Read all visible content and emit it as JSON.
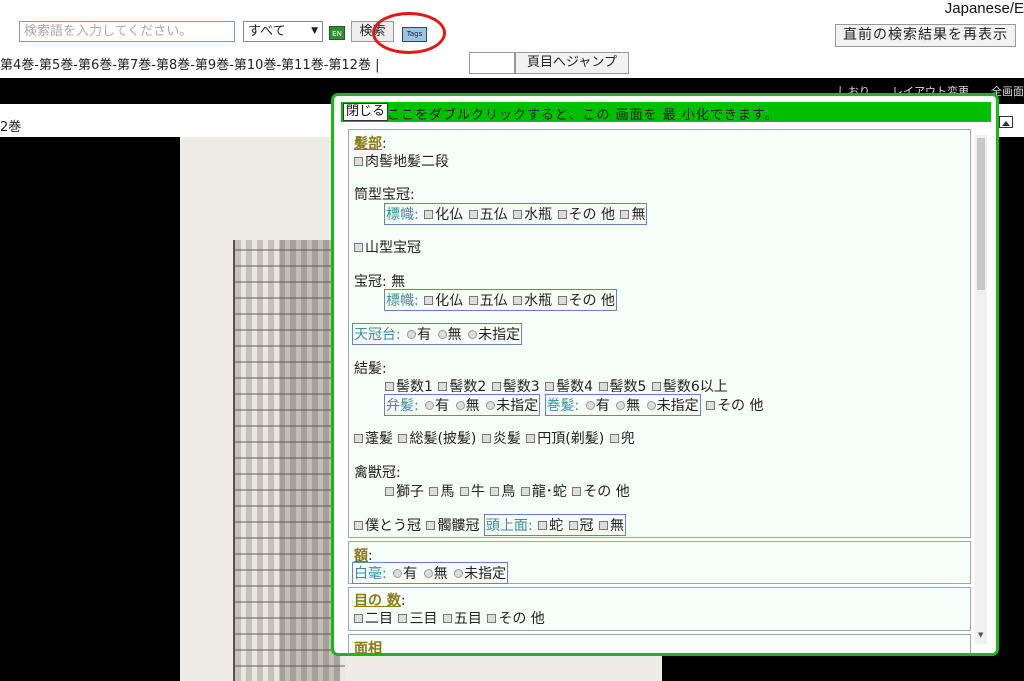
{
  "header": {
    "language": "Japanese/E",
    "search_placeholder": "検索語を入力してください。",
    "scope_selected": "すべて",
    "en_badge": "EN",
    "search_label": "検索",
    "tags_label": "Tags",
    "redisplay_label": "直前の検索結果を再表示"
  },
  "volume_nav": {
    "items": [
      "第4巻",
      "第5巻",
      "第6巻",
      "第7巻",
      "第8巻",
      "第9巻",
      "第10巻",
      "第11巻",
      "第12巻"
    ],
    "page_jump_label": "頁目へジャンプ"
  },
  "viewer": {
    "volume_label": "2巻",
    "toolbar_text": "しおり　　レイアウト変更　　全画面"
  },
  "tags_panel": {
    "close_label": "閉じる",
    "header_text": "ここをダブルクリックすると、この 画面を 最 小化できます。",
    "hair": {
      "title": "髪部",
      "l1": "肉髻地髪二段",
      "l2": "筒型宝冠:",
      "l3_label": "標幟:",
      "l3": [
        "化仏",
        "五仏",
        "水瓶",
        "その 他",
        "無"
      ],
      "l4": "山型宝冠",
      "l5": "宝冠: 無",
      "l6_label": "標幟:",
      "l6": [
        "化仏",
        "五仏",
        "水瓶",
        "その 他"
      ],
      "l7_label": "天冠台:",
      "l7": [
        "有",
        "無",
        "未指定"
      ],
      "l8": "結髪:",
      "l9": [
        "髻数1",
        "髻数2",
        "髻数3",
        "髻数4",
        "髻数5",
        "髻数6以上"
      ],
      "l10a_label": "弁髪:",
      "l10a": [
        "有",
        "無",
        "未指定"
      ],
      "l10b_label": "巻髪:",
      "l10b": [
        "有",
        "無",
        "未指定"
      ],
      "l10c": "その 他",
      "l11": [
        "蓬髪",
        "総髪(披髪)",
        "炎髪",
        "円頂(剃髪)",
        "兜"
      ],
      "l12": "禽獣冠:",
      "l13": [
        "獅子",
        "馬",
        "牛",
        "鳥",
        "龍･蛇",
        "その 他"
      ],
      "l14": [
        "僕とう冠",
        "髑髏冠"
      ],
      "l14_label": "頭上面:",
      "l14_opts": [
        "蛇",
        "冠",
        "無"
      ]
    },
    "forehead": {
      "title": "額",
      "label": "白毫:",
      "opts": [
        "有",
        "無",
        "未指定"
      ]
    },
    "eyes": {
      "title": "目の 数",
      "opts": [
        "二目",
        "三目",
        "五目",
        "その 他"
      ]
    },
    "face": {
      "title": "面相"
    }
  }
}
